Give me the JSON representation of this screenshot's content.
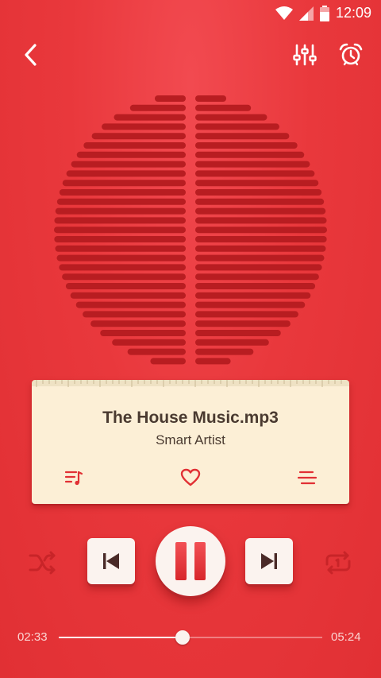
{
  "status_bar": {
    "time": "12:09",
    "icons": [
      "wifi-icon",
      "cell-signal-icon",
      "battery-icon"
    ]
  },
  "toolbar": {
    "back_icon": "chevron-left-icon",
    "equalizer_icon": "equalizer-icon",
    "alarm_icon": "alarm-clock-icon"
  },
  "now_playing": {
    "title": "The House Music.mp3",
    "artist": "Smart Artist"
  },
  "card_actions": {
    "playlist_icon": "playlist-icon",
    "favorite_icon": "heart-icon",
    "menu_icon": "menu-lines-icon"
  },
  "controls": {
    "shuffle_icon": "shuffle-icon",
    "previous_icon": "skip-previous-icon",
    "pause_icon": "pause-icon",
    "next_icon": "skip-next-icon",
    "repeat_icon": "repeat-one-icon"
  },
  "progress": {
    "elapsed": "02:33",
    "total": "05:24",
    "fraction": 0.47
  },
  "colors": {
    "background": "#e9383c",
    "card": "#fcefd6",
    "button": "#fbf3ef",
    "accent": "#e13034"
  }
}
